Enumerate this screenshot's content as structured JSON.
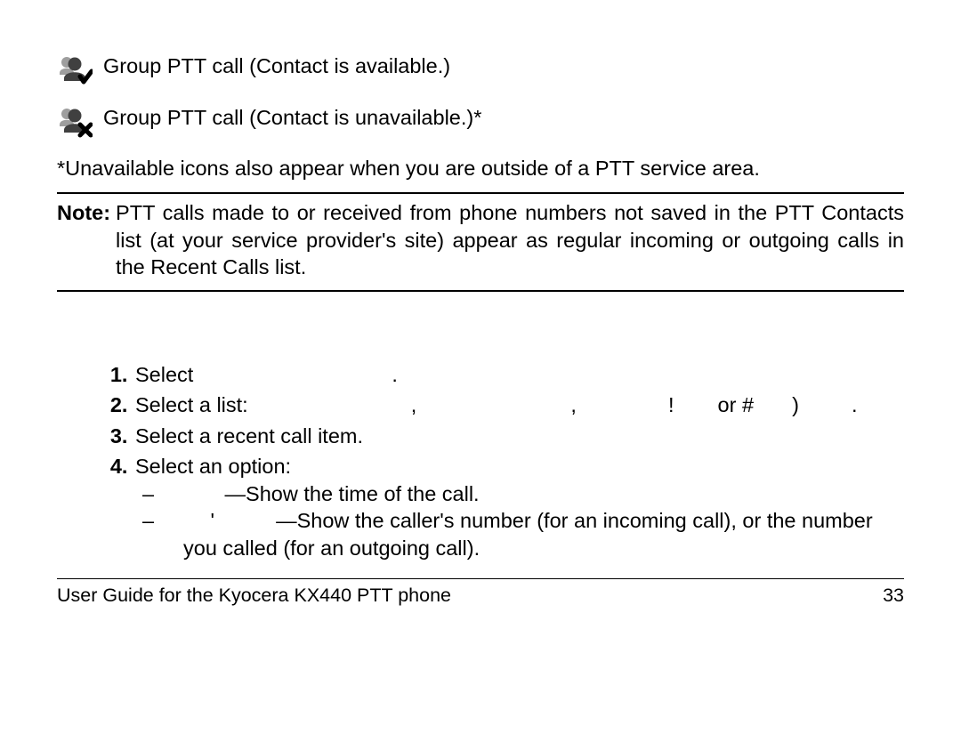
{
  "icons": {
    "available": {
      "name": "group-check-icon",
      "text": "Group PTT call (Contact is available.)"
    },
    "unavailable": {
      "name": "group-x-icon",
      "text": "Group PTT call (Contact is unavailable.)*"
    }
  },
  "footnote": "*Unavailable icons also appear when you are outside of a PTT service area.",
  "note": {
    "label": "Note:",
    "text": "PTT calls made to or received from phone numbers not saved in the PTT Contacts list (at your service provider's site) appear as regular incoming or outgoing calls in the Recent Calls list."
  },
  "steps": {
    "s1_prefix": "Select",
    "s1_suffix": ".",
    "s2_prefix": "Select a list:",
    "s2_mid1": ",",
    "s2_mid2": ",",
    "s2_mid3": "!",
    "s2_mid4": "or #",
    "s2_mid5": ")",
    "s2_end": ".",
    "s3": "Select a recent call item.",
    "s4": "Select an option:",
    "s4a_lead": "'",
    "s4a_text": "—Show the time of the call.",
    "s4b_lead": "'",
    "s4b_text": "—Show the caller's number (for an incoming call), or the number you called (for an outgoing call)."
  },
  "footer": {
    "left": "User Guide for the Kyocera KX440 PTT phone",
    "right": "33"
  }
}
